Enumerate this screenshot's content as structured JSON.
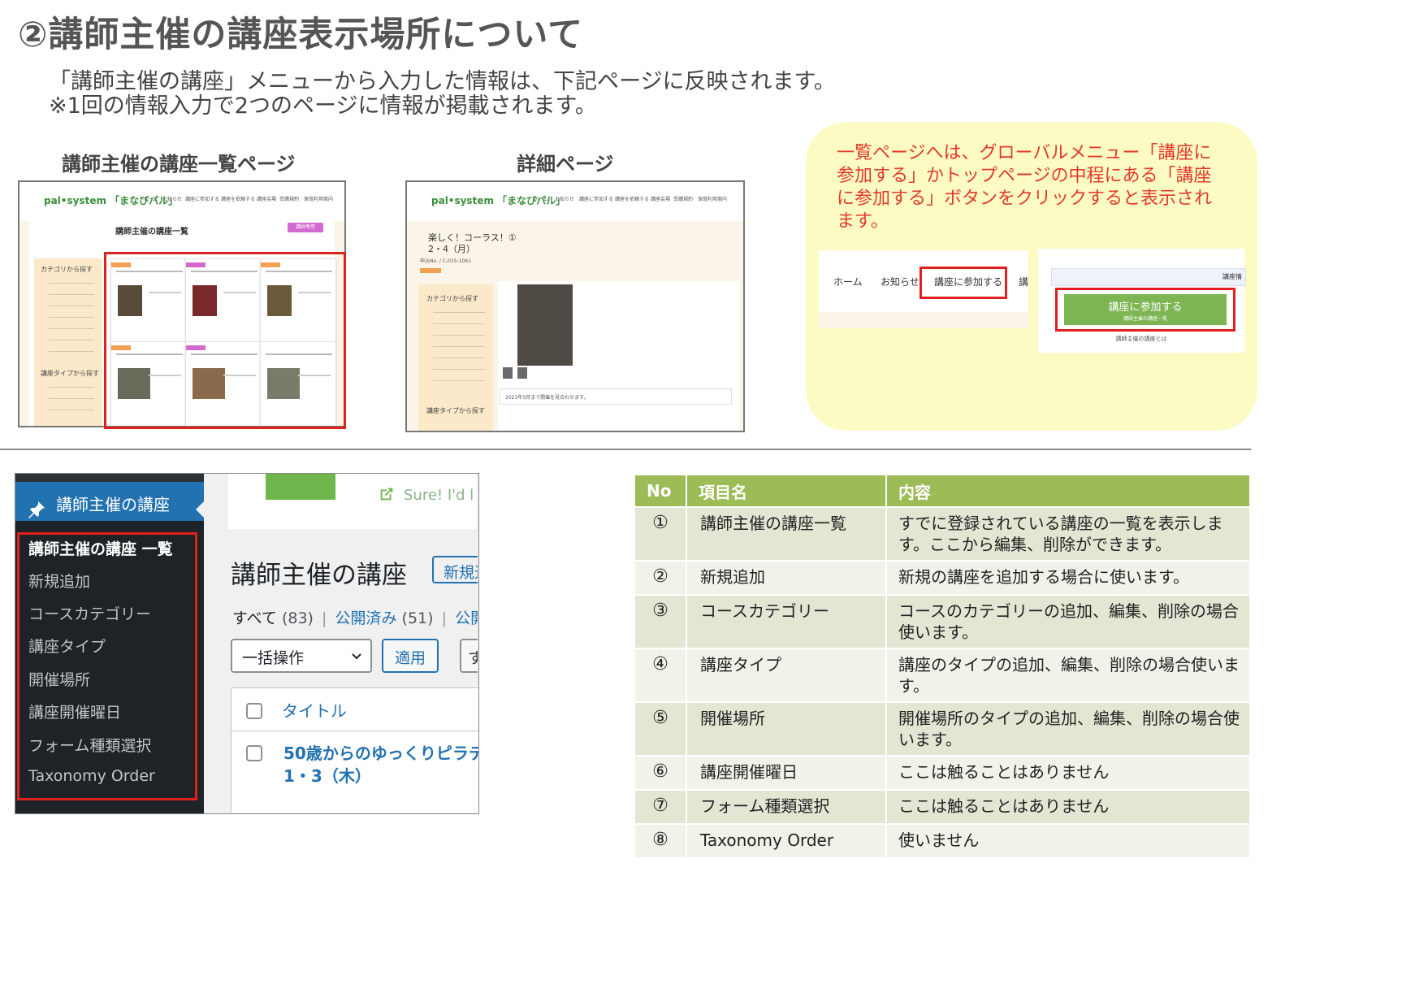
{
  "page": {
    "title": "②講師主催の講座表示場所について",
    "intro_line1": "「講師主催の講座」メニューから入力した情報は、下記ページに反映されます。",
    "intro_line2": "※1回の情報入力で2つのページに情報が掲載されます。"
  },
  "list_section": {
    "label": "講師主催の講座一覧ページ"
  },
  "detail_section": {
    "label": "詳細ページ"
  },
  "site": {
    "logo": "pal•system 「まなびパル」",
    "menu": [
      "ホーム",
      "お知らせ",
      "講座に参加する",
      "講座を依頼する",
      "講座会場",
      "受講規約",
      "保育利用案内"
    ],
    "list_page_heading": "講師主催の講座一覧",
    "list_button": "講師専用",
    "sidebar_category": "カテゴリから探す",
    "sidebar_type": "講座タイプから探す",
    "detail_title": "楽しく！コーラス！①",
    "detail_date": "2・4（月）",
    "detail_code": "申込No. / C-015-1061",
    "detail_note": "2021年3月まで開催を見合わせます。"
  },
  "callout": {
    "text": "一覧ページへは、グローバルメニュー「講座に参加する」かトップページの中程にある「講座に参加する」ボタンをクリックすると表示されます。",
    "nav_home": "ホーム",
    "nav_news": "お知らせ",
    "nav_join": "講座に参加する",
    "nav_partial": "講座",
    "top_partial": "講座情",
    "green_button": "講座に参加する",
    "green_button_sub": "講師主催の講座一覧",
    "below_button": "講師主催の講座とは"
  },
  "wp": {
    "menu_title": "講師主催の講座",
    "submenu": [
      "講師主催の講座 一覧",
      "新規追加",
      "コースカテゴリー",
      "講座タイプ",
      "開催場所",
      "講座開催曜日",
      "フォーム種類選択",
      "Taxonomy Order"
    ],
    "notice_text": "Sure! I'd l",
    "page_title": "講師主催の講座",
    "new_button": "新規追",
    "filter_all": "すべて",
    "filter_all_count": "(83)",
    "filter_published": "公開済み",
    "filter_published_count": "(51)",
    "filter_partial": "公開",
    "bulk_action": "一括操作",
    "apply_button": "適用",
    "partial_button": "す",
    "col_title": "タイトル",
    "row_title_line1": "50歳からのゆっくりピラテ",
    "row_title_line2": "1・3（木）"
  },
  "table": {
    "headers": [
      "No",
      "項目名",
      "内容"
    ],
    "rows": [
      {
        "no": "①",
        "name": "講師主催の講座一覧",
        "desc": "すでに登録されている講座の一覧を表示します。ここから編集、削除ができます。"
      },
      {
        "no": "②",
        "name": "新規追加",
        "desc": "新規の講座を追加する場合に使います。"
      },
      {
        "no": "③",
        "name": "コースカテゴリー",
        "desc": "コースのカテゴリーの追加、編集、削除の場合使います。"
      },
      {
        "no": "④",
        "name": "講座タイプ",
        "desc": "講座のタイプの追加、編集、削除の場合使います。"
      },
      {
        "no": "⑤",
        "name": "開催場所",
        "desc": "開催場所のタイプの追加、編集、削除の場合使います。"
      },
      {
        "no": "⑥",
        "name": "講座開催曜日",
        "desc": "ここは触ることはありません"
      },
      {
        "no": "⑦",
        "name": "フォーム種類選択",
        "desc": "ここは触ることはありません"
      },
      {
        "no": "⑧",
        "name": "Taxonomy Order",
        "desc": "使いません"
      }
    ]
  },
  "colors": {
    "accent_red": "#e0201c",
    "wp_blue": "#2271b1",
    "table_header": "#9dbb57",
    "callout_bg": "#fdfbc4",
    "callout_text": "#e23a2a",
    "site_green_button": "#7cb552"
  }
}
